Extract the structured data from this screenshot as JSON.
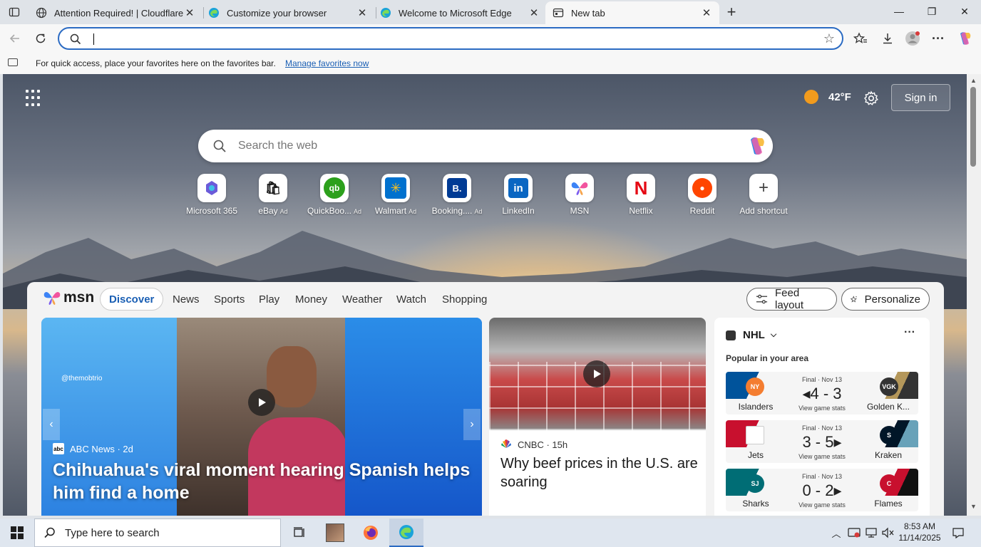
{
  "browser": {
    "tabs": [
      {
        "label": "Attention Required! | Cloudflare",
        "icon": "globe-icon"
      },
      {
        "label": "Customize your browser",
        "icon": "edge-icon"
      },
      {
        "label": "Welcome to Microsoft Edge",
        "icon": "edge-icon"
      },
      {
        "label": "New tab",
        "icon": "new-tab-page-icon",
        "active": true
      }
    ],
    "close_glyph": "✕",
    "new_tab_glyph": "+",
    "window_controls": {
      "minimize": "—",
      "restore": "❐",
      "close": "✕"
    },
    "address_bar": {
      "value": "",
      "placeholder": ""
    },
    "favorites_bar": {
      "message": "For quick access, place your favorites here on the favorites bar.",
      "link": "Manage favorites now"
    }
  },
  "newtab": {
    "weather": {
      "temp": "42°F"
    },
    "sign_in": "Sign in",
    "search": {
      "placeholder": "Search the web"
    },
    "shortcuts": [
      {
        "label": "Microsoft 365",
        "ad": ""
      },
      {
        "label": "eBay",
        "ad": "Ad"
      },
      {
        "label": "QuickBoo...",
        "ad": "Ad"
      },
      {
        "label": "Walmart",
        "ad": "Ad"
      },
      {
        "label": "Booking....",
        "ad": "Ad"
      },
      {
        "label": "LinkedIn",
        "ad": ""
      },
      {
        "label": "MSN",
        "ad": ""
      },
      {
        "label": "Netflix",
        "ad": ""
      },
      {
        "label": "Reddit",
        "ad": ""
      },
      {
        "label": "Add shortcut",
        "ad": ""
      }
    ],
    "tile_glyphs": {
      "ebay": "🛍",
      "quickbooks": "qb",
      "walmart": "✳",
      "booking": "B.",
      "linkedin": "in",
      "netflix": "N",
      "reddit": "●",
      "add": "+"
    },
    "colors": {
      "quickbooks": "#2ca01c",
      "walmart": "#0071ce",
      "booking": "#003b95",
      "linkedin": "#0a66c2",
      "netflix": "#e50914",
      "reddit": "#ff4500"
    }
  },
  "feed": {
    "brand": "msn",
    "tabs": [
      "Discover",
      "News",
      "Sports",
      "Play",
      "Money",
      "Weather",
      "Watch",
      "Shopping"
    ],
    "feed_layout": "Feed layout",
    "personalize": "Personalize",
    "hero": {
      "handle": "@themobtrio",
      "source": "ABC News",
      "age": "2d",
      "source_logo": "abc",
      "title": "Chihuahua's viral moment hearing Spanish helps him find a home"
    },
    "card2": {
      "source": "CNBC",
      "age": "15h",
      "title": "Why beef prices in the U.S. are soaring"
    },
    "nhl": {
      "header": "NHL",
      "more": "···",
      "subtitle": "Popular in your area",
      "games": [
        {
          "status": "Final · Nov 13",
          "score": "◂4 - 3",
          "stats": "View game stats",
          "home": "Islanders",
          "away": "Golden K..."
        },
        {
          "status": "Final · Nov 13",
          "score": "3 - 5▸",
          "stats": "View game stats",
          "home": "Jets",
          "away": "Kraken"
        },
        {
          "status": "Final · Nov 13",
          "score": "0 - 2▸",
          "stats": "View game stats",
          "home": "Sharks",
          "away": "Flames"
        }
      ]
    }
  },
  "taskbar": {
    "search_placeholder": "Type here to search",
    "time": "8:53 AM",
    "date": "11/14/2025"
  }
}
